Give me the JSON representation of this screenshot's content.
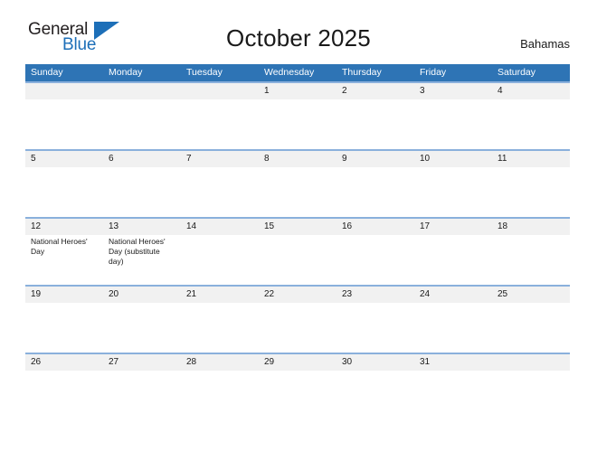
{
  "branding": {
    "logo_text_primary": "General",
    "logo_text_secondary": "Blue",
    "logo_color_primary": "#231f20",
    "logo_color_secondary": "#1d6fb8"
  },
  "header": {
    "title": "October 2025",
    "region": "Bahamas"
  },
  "theme": {
    "header_blue": "#2e74b5",
    "row_divider_blue": "#8ab0dc",
    "date_band_gray": "#f1f1f1",
    "text_dark": "#1a1a1a",
    "text_on_blue": "#ffffff"
  },
  "calendar": {
    "weekdays": [
      "Sunday",
      "Monday",
      "Tuesday",
      "Wednesday",
      "Thursday",
      "Friday",
      "Saturday"
    ],
    "weeks": [
      [
        {
          "date": "",
          "event": ""
        },
        {
          "date": "",
          "event": ""
        },
        {
          "date": "",
          "event": ""
        },
        {
          "date": "1",
          "event": ""
        },
        {
          "date": "2",
          "event": ""
        },
        {
          "date": "3",
          "event": ""
        },
        {
          "date": "4",
          "event": ""
        }
      ],
      [
        {
          "date": "5",
          "event": ""
        },
        {
          "date": "6",
          "event": ""
        },
        {
          "date": "7",
          "event": ""
        },
        {
          "date": "8",
          "event": ""
        },
        {
          "date": "9",
          "event": ""
        },
        {
          "date": "10",
          "event": ""
        },
        {
          "date": "11",
          "event": ""
        }
      ],
      [
        {
          "date": "12",
          "event": "National Heroes' Day"
        },
        {
          "date": "13",
          "event": "National Heroes' Day (substitute day)"
        },
        {
          "date": "14",
          "event": ""
        },
        {
          "date": "15",
          "event": ""
        },
        {
          "date": "16",
          "event": ""
        },
        {
          "date": "17",
          "event": ""
        },
        {
          "date": "18",
          "event": ""
        }
      ],
      [
        {
          "date": "19",
          "event": ""
        },
        {
          "date": "20",
          "event": ""
        },
        {
          "date": "21",
          "event": ""
        },
        {
          "date": "22",
          "event": ""
        },
        {
          "date": "23",
          "event": ""
        },
        {
          "date": "24",
          "event": ""
        },
        {
          "date": "25",
          "event": ""
        }
      ],
      [
        {
          "date": "26",
          "event": ""
        },
        {
          "date": "27",
          "event": ""
        },
        {
          "date": "28",
          "event": ""
        },
        {
          "date": "29",
          "event": ""
        },
        {
          "date": "30",
          "event": ""
        },
        {
          "date": "31",
          "event": ""
        },
        {
          "date": "",
          "event": ""
        }
      ]
    ]
  }
}
